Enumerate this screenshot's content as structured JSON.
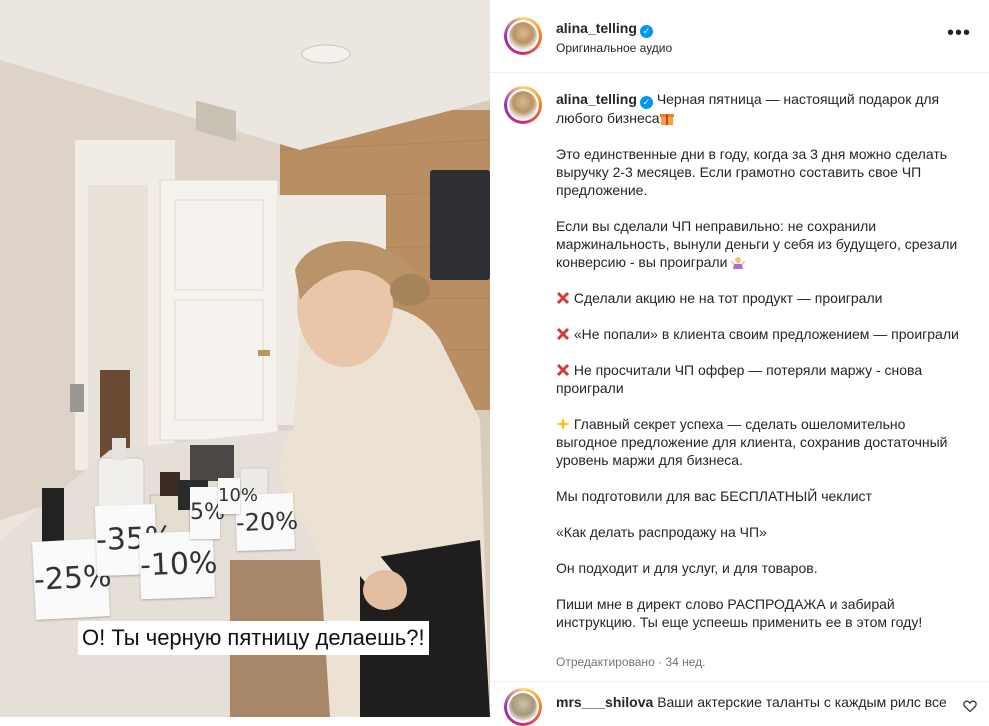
{
  "media": {
    "overlay_caption": "О! Ты черную пятницу делаешь?!",
    "price_tags": [
      "-25%",
      "-35%",
      "-10%",
      "5%",
      "-20%",
      "10%"
    ]
  },
  "header": {
    "username": "alina_telling",
    "audio": "Оригинальное аудио",
    "more_label": "•••"
  },
  "post": {
    "username": "alina_telling",
    "paragraphs": [
      "Черная пятница — настоящий подарок для любого бизнеса",
      "Это единственные дни в году, когда за 3 дня можно сделать выручку 2-3 месяцев. Если грамотно составить свое ЧП предложение.",
      "Если вы сделали ЧП неправильно: не сохранили маржинальность, вынули деньги у себя из будущего, срезали конверсию - вы проиграли",
      "Сделали акцию не на тот продукт — проиграли",
      "«Не попали» в клиента своим предложением — проиграли",
      "Не просчитали ЧП оффер — потеряли маржу - снова проиграли",
      "Главный секрет успеха — сделать ошеломительно выгодное предложение для клиента, сохранив достаточный уровень маржи для бизнеса.",
      "Мы подготовили для вас БЕСПЛАТНЫЙ чеклист",
      "«Как делать распродажу на ЧП»",
      "Он подходит и для услуг, и для товаров.",
      "Пиши мне в директ слово РАСПРОДАЖА и забирай инструкцию. Ты еще успеешь применить ее в этом году!"
    ],
    "edited": "Отредактировано",
    "age": "34 нед."
  },
  "comment": {
    "username": "mrs___shilova",
    "text": "Ваши актерские таланты с каждым рилс все"
  },
  "colors": {
    "verified": "#0095f6",
    "cross": "#d43c3c",
    "text": "#262626",
    "muted": "#737373"
  },
  "icons": [
    "verified-icon",
    "more-options-icon",
    "gift-emoji-icon",
    "person-shrugging-emoji-icon",
    "cross-mark-icon",
    "sparkles-icon",
    "heart-icon"
  ]
}
